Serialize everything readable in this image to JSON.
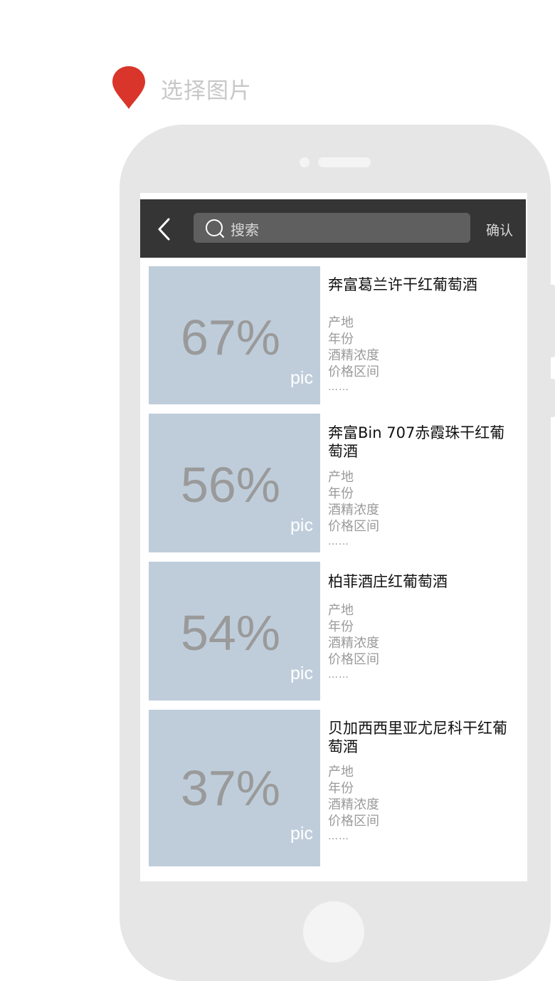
{
  "header": {
    "title": "选择图片",
    "marker_icon": "location-pin-icon",
    "marker_color": "#d9352a"
  },
  "navbar": {
    "back_icon": "chevron-left-icon",
    "search_icon": "search-icon",
    "search_placeholder": "搜索",
    "confirm_label": "确认"
  },
  "items": [
    {
      "title": "奔富葛兰许干红葡萄酒",
      "percent": "67%",
      "pic_label": "pic",
      "attrs": [
        "产地",
        "年份",
        "酒精浓度",
        "价格区间"
      ],
      "more": "……"
    },
    {
      "title": "奔富Bin 707赤霞珠干红葡萄酒",
      "percent": "56%",
      "pic_label": "pic",
      "attrs": [
        "产地",
        "年份",
        "酒精浓度",
        "价格区间"
      ],
      "more": "……"
    },
    {
      "title": "柏菲酒庄红葡萄酒",
      "percent": "54%",
      "pic_label": "pic",
      "attrs": [
        "产地",
        "年份",
        "酒精浓度",
        "价格区间"
      ],
      "more": "……"
    },
    {
      "title": "贝加西西里亚尤尼科干红葡萄酒",
      "percent": "37%",
      "pic_label": "pic",
      "attrs": [
        "产地",
        "年份",
        "酒精浓度",
        "价格区间"
      ],
      "more": "……"
    }
  ],
  "colors": {
    "navbar_bg": "#353535",
    "search_bg": "#5f5f5f",
    "pic_bg": "#bfcddb",
    "phone_frame": "#e6e6e6"
  }
}
